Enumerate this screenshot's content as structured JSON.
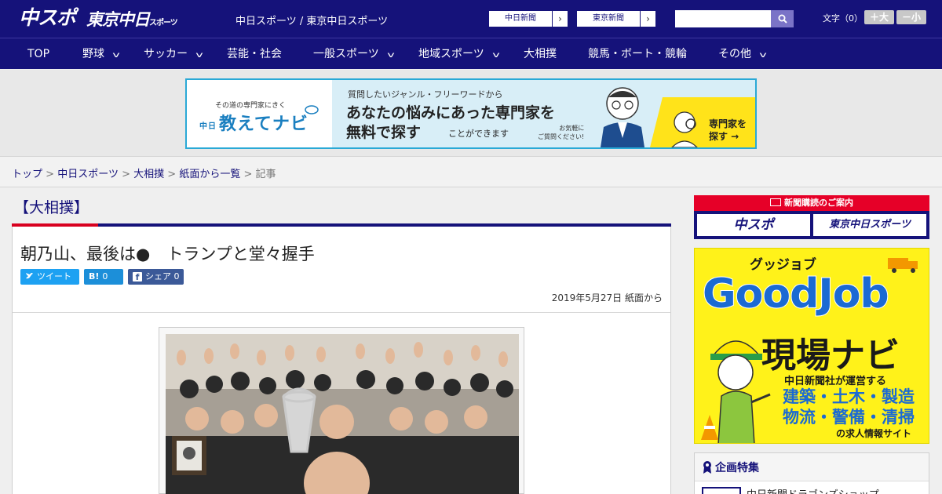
{
  "header": {
    "logo_main": "中スポ",
    "logo_tokyo": "東京中日",
    "logo_tokyo_suffix": "スポーツ",
    "site_title": "中日スポーツ / 東京中日スポーツ",
    "paper_links": [
      "中日新聞",
      "東京新聞"
    ],
    "search_placeholder": "",
    "font_size_label": "文字（0）",
    "font_larger": "＋大",
    "font_smaller": "－小"
  },
  "nav": {
    "items": [
      {
        "label": "TOP",
        "dropdown": false
      },
      {
        "label": "野球",
        "dropdown": true
      },
      {
        "label": "サッカー",
        "dropdown": true
      },
      {
        "label": "芸能・社会",
        "dropdown": false
      },
      {
        "label": "一般スポーツ",
        "dropdown": true
      },
      {
        "label": "地域スポーツ",
        "dropdown": true
      },
      {
        "label": "大相撲",
        "dropdown": false
      },
      {
        "label": "競馬・ボート・競輪",
        "dropdown": false
      },
      {
        "label": "その他",
        "dropdown": true
      }
    ]
  },
  "ad_banner": {
    "tagline": "その道の専門家にきく",
    "brand_prefix": "中日",
    "brand": "教えてナビ",
    "question": "質問したいジャンル・フリーワードから",
    "headline1": "あなたの悩みにあった専門家を",
    "headline2": "無料で探す",
    "headline2_tail": "ことができます",
    "note_line1": "お気軽に",
    "note_line2": "ご質問ください!",
    "cta_line1": "専門家を",
    "cta_line2": "探す →"
  },
  "breadcrumb": {
    "links": [
      "トップ",
      "中日スポーツ",
      "大相撲",
      "紙面から一覧"
    ],
    "separator": ">",
    "current": "記事"
  },
  "article": {
    "category": "【大相撲】",
    "title": "朝乃山、最後は●　トランプと堂々握手",
    "share": {
      "tweet_label": "ツイート",
      "hatena_mark": "B!",
      "hatena_count": "0",
      "facebook_label": "シェア",
      "facebook_count": "0"
    },
    "date": "2019年5月27日",
    "source": "紙面から"
  },
  "sidebar": {
    "subscribe_header": "新聞購読のご案内",
    "subscribe_buttons": [
      "中スポ",
      "東京中日スポーツ"
    ],
    "goodjob": {
      "kana": "グッジョブ",
      "title": "GoodJob",
      "subtitle": "現場ナビ",
      "line1": "中日新聞社が運営する",
      "line2a": "建築・土木・製造",
      "line2b": "物流・警備・清掃",
      "line3": "の求人情報サイト"
    },
    "feature_title": "企画特集",
    "feature_item": "中日新聞ドラゴンズショップ"
  },
  "colors": {
    "brand_navy": "#15127a",
    "accent_red": "#d8001f",
    "twitter": "#1da1f2",
    "hatena": "#1c8fd9",
    "facebook": "#3b5998",
    "goodjob_yellow": "#fff21a"
  }
}
